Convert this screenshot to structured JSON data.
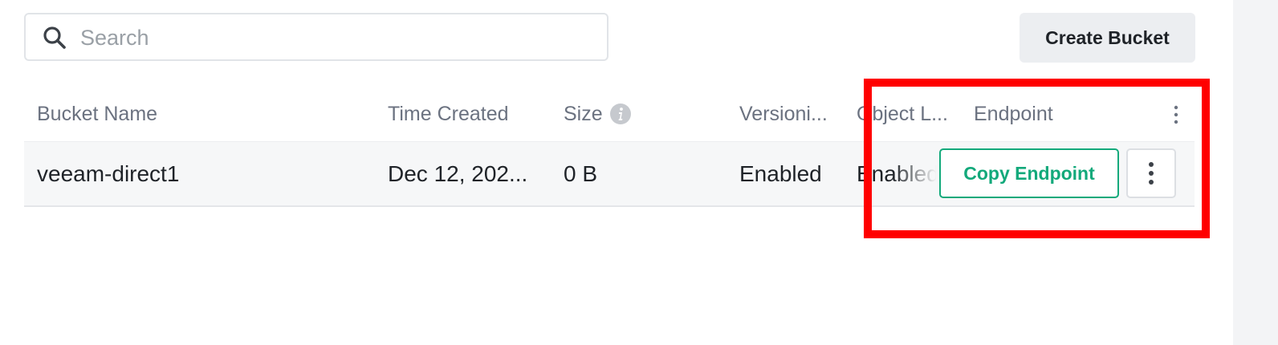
{
  "search": {
    "placeholder": "Search",
    "value": ""
  },
  "toolbar": {
    "create_bucket_label": "Create Bucket"
  },
  "table": {
    "columns": [
      {
        "label": "Bucket Name"
      },
      {
        "label": "Time Created"
      },
      {
        "label": "Size"
      },
      {
        "label": "Versioni..."
      },
      {
        "label": "Object L..."
      },
      {
        "label": "Endpoint"
      }
    ],
    "rows": [
      {
        "bucket_name": "veeam-direct1",
        "time_created": "Dec 12, 202...",
        "size": "0 B",
        "versioning": "Enabled",
        "object_lock": "Enabled",
        "endpoint_button_label": "Copy Endpoint"
      }
    ]
  },
  "icons": {
    "search": "search-icon",
    "size_info": "info-icon",
    "column_menu": "kebab-menu-icon",
    "row_menu": "kebab-menu-icon"
  },
  "colors": {
    "accent_green": "#13a97b",
    "highlight_red": "#ff0000",
    "row_background": "#f6f7f8",
    "header_text": "#6b7280"
  }
}
